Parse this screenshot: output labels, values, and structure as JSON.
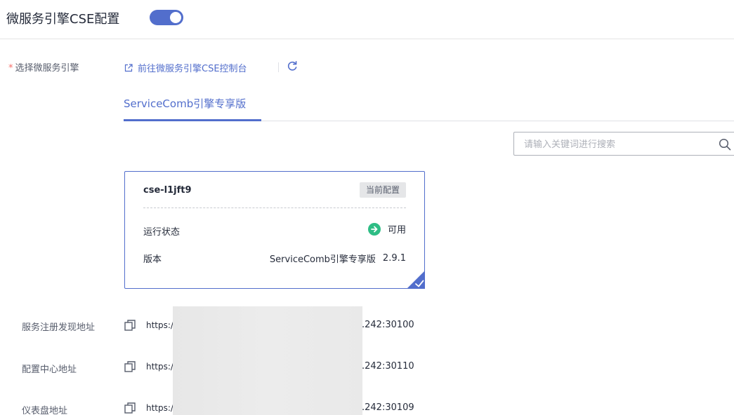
{
  "header": {
    "title": "微服务引擎CSE配置",
    "toggle_state": "on",
    "accent_color": "#526ecc"
  },
  "engine_select": {
    "required_mark": "*",
    "label": "选择微服务引擎",
    "console_link": "前往微服务引擎CSE控制台",
    "link_icon": "external-link-icon",
    "refresh_icon": "refresh-icon"
  },
  "tabs": [
    {
      "label": "ServiceComb引擎专享版",
      "active": true
    }
  ],
  "search": {
    "placeholder": "请输入关键词进行搜索",
    "value": "",
    "icon": "search-icon"
  },
  "engine_card": {
    "name": "cse-l1jft9",
    "badge": "当前配置",
    "status_label": "运行状态",
    "status_value": "可用",
    "status_color": "#2ebd85",
    "version_label": "版本",
    "version_edition": "ServiceComb引擎专享版",
    "version_number": "2.9.1",
    "selected": true
  },
  "addresses": [
    {
      "label": "服务注册发现地址",
      "prefix": "https:/",
      "suffix": ".242:30100"
    },
    {
      "label": "配置中心地址",
      "prefix": "https:/",
      "suffix": ".242:30110"
    },
    {
      "label": "仪表盘地址",
      "prefix": "https:/",
      "suffix": ".242:30109"
    }
  ]
}
